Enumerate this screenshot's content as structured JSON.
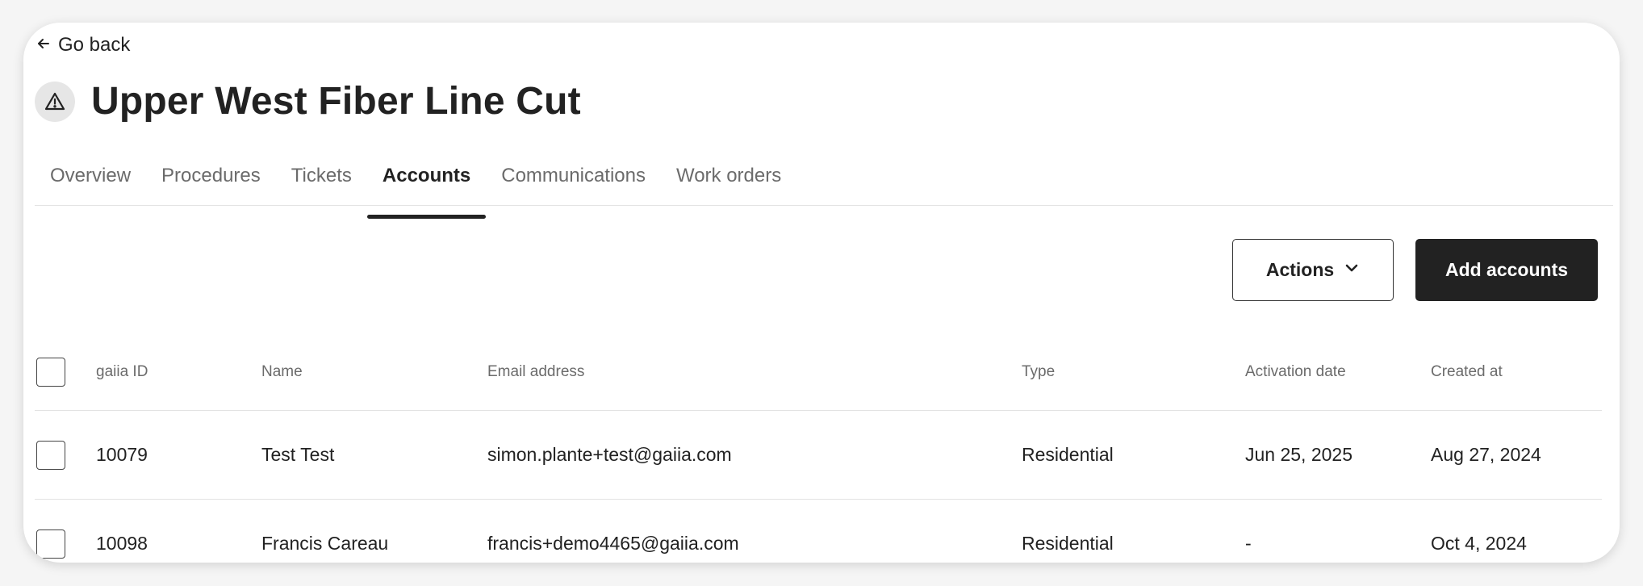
{
  "nav": {
    "go_back_label": "Go back"
  },
  "page": {
    "title": "Upper West Fiber Line Cut",
    "incident_icon": "warning-triangle-icon"
  },
  "tabs": [
    {
      "label": "Overview",
      "active": false
    },
    {
      "label": "Procedures",
      "active": false
    },
    {
      "label": "Tickets",
      "active": false
    },
    {
      "label": "Accounts",
      "active": true
    },
    {
      "label": "Communications",
      "active": false
    },
    {
      "label": "Work orders",
      "active": false
    }
  ],
  "toolbar": {
    "actions_label": "Actions",
    "add_accounts_label": "Add accounts"
  },
  "table": {
    "columns": {
      "id": "gaiia ID",
      "name": "Name",
      "email": "Email address",
      "type": "Type",
      "activation_date": "Activation date",
      "created_at": "Created at"
    },
    "rows": [
      {
        "id": "10079",
        "name": "Test Test",
        "email": "simon.plante+test@gaiia.com",
        "type": "Residential",
        "activation_date": "Jun 25, 2025",
        "created_at": "Aug 27, 2024"
      },
      {
        "id": "10098",
        "name": "Francis Careau",
        "email": "francis+demo4465@gaiia.com",
        "type": "Residential",
        "activation_date": "-",
        "created_at": "Oct 4, 2024"
      }
    ]
  },
  "colors": {
    "primary_button_bg": "#222222",
    "active_tab_underline": "#222222",
    "muted_text": "#6b6b6b"
  }
}
